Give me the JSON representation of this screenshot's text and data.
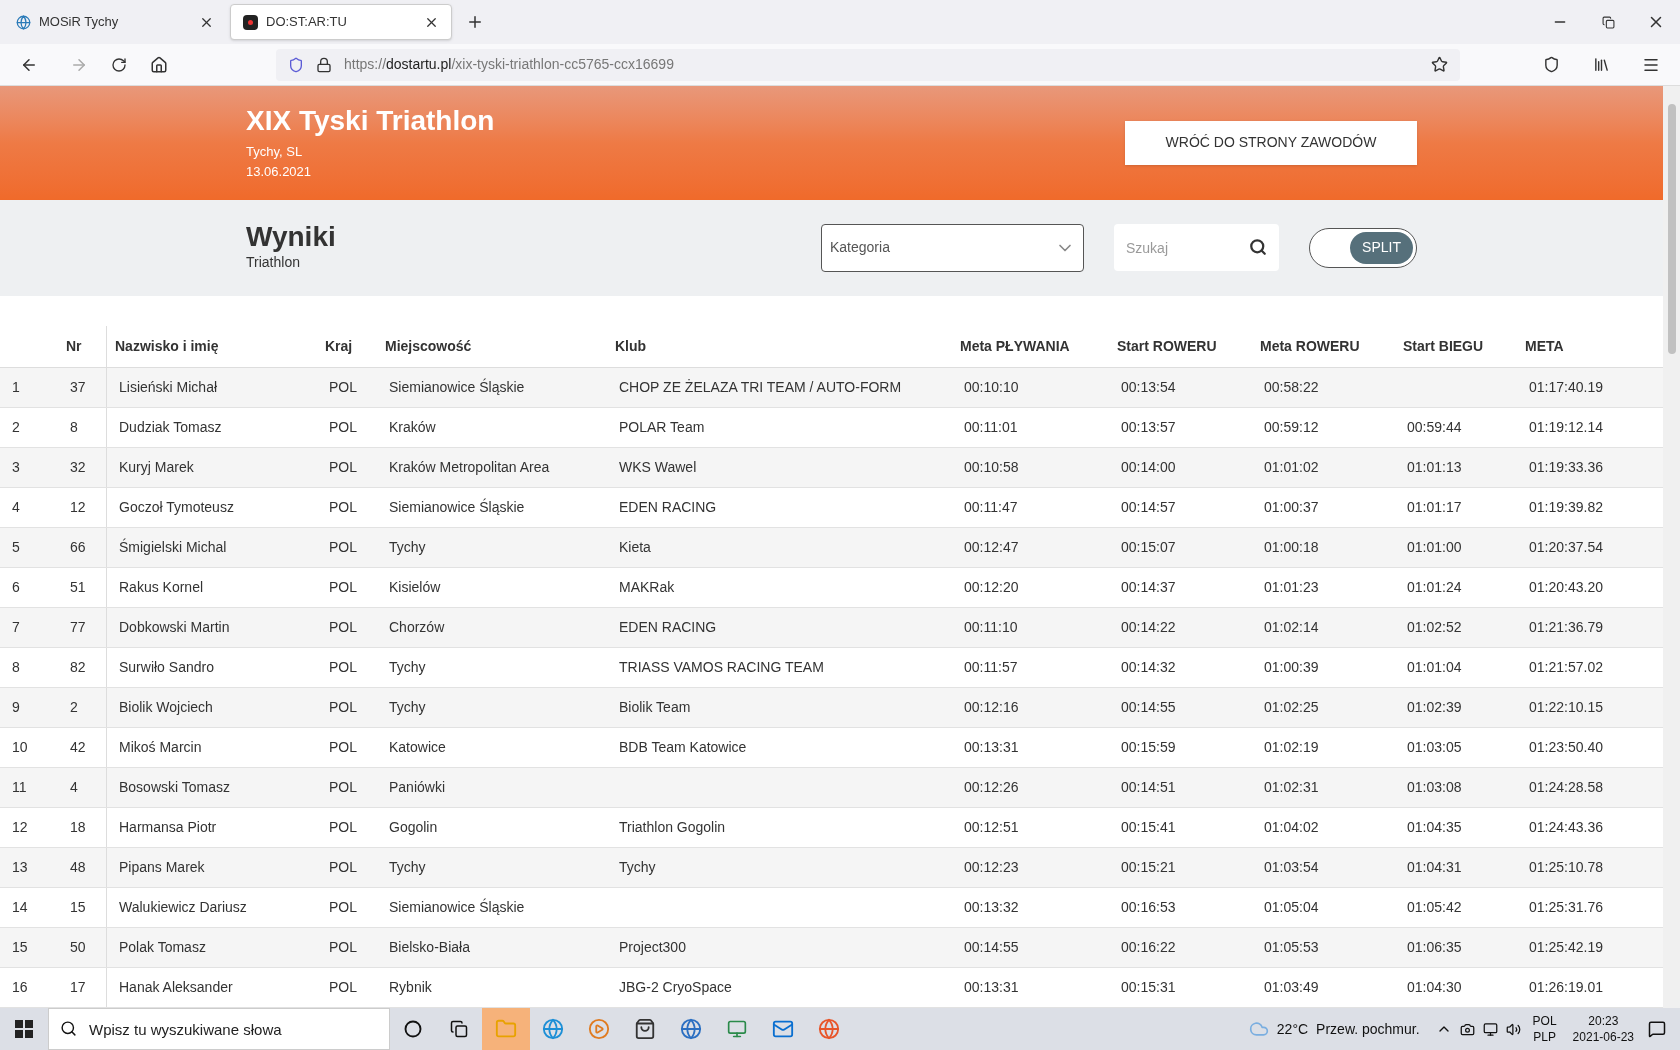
{
  "browser": {
    "tabs": [
      {
        "title": "MOSiR Tychy",
        "selected": false
      },
      {
        "title": "DO:ST:AR:TU",
        "selected": true
      }
    ],
    "url": {
      "scheme": "https://",
      "domain": "dostartu.pl",
      "path": "/xix-tyski-triathlon-cc5765-ccx16699"
    }
  },
  "event": {
    "title": "XIX Tyski Triathlon",
    "location": "Tychy, SL",
    "date": "13.06.2021",
    "back_button": "WRÓĆ DO STRONY ZAWODÓW"
  },
  "results": {
    "title": "Wyniki",
    "subtitle": "Triathlon",
    "category_placeholder": "Kategoria",
    "search_placeholder": "Szukaj",
    "split": {
      "label": "SPLIT",
      "on": true
    }
  },
  "table": {
    "columns": [
      "",
      "Nr",
      "Nazwisko i imię",
      "Kraj",
      "Miejscowość",
      "Klub",
      "Meta PŁYWANIA",
      "Start ROWERU",
      "Meta ROWERU",
      "Start BIEGU",
      "META"
    ],
    "rows": [
      {
        "place": "1",
        "nr": "37",
        "name": "Lisieński Michał",
        "country": "POL",
        "city": "Siemianowice Śląskie",
        "club": "CHOP ZE ŻELAZA TRI TEAM / AUTO-FORM",
        "swim_finish": "00:10:10",
        "bike_start": "00:13:54",
        "bike_finish": "00:58:22",
        "finish": "01:17:40.19"
      },
      {
        "place": "2",
        "nr": "8",
        "name": "Dudziak Tomasz",
        "country": "POL",
        "city": "Kraków",
        "club": "POLAR Team",
        "swim_finish": "00:11:01",
        "bike_start": "00:13:57",
        "bike_finish": "00:59:12",
        "run_start": "00:59:44",
        "finish": "01:19:12.14"
      },
      {
        "place": "3",
        "nr": "32",
        "name": "Kuryj Marek",
        "country": "POL",
        "city": "Kraków Metropolitan Area",
        "club": "WKS Wawel",
        "swim_finish": "00:10:58",
        "bike_start": "00:14:00",
        "bike_finish": "01:01:02",
        "run_start": "01:01:13",
        "finish": "01:19:33.36"
      },
      {
        "place": "4",
        "nr": "12",
        "name": "Goczoł Tymoteusz",
        "country": "POL",
        "city": "Siemianowice Śląskie",
        "club": "EDEN RACING",
        "swim_finish": "00:11:47",
        "bike_start": "00:14:57",
        "bike_finish": "01:00:37",
        "run_start": "01:01:17",
        "finish": "01:19:39.82"
      },
      {
        "place": "5",
        "nr": "66",
        "name": "Śmigielski Michal",
        "country": "POL",
        "city": "Tychy",
        "club": "Kieta",
        "swim_finish": "00:12:47",
        "bike_start": "00:15:07",
        "bike_finish": "01:00:18",
        "run_start": "01:01:00",
        "finish": "01:20:37.54"
      },
      {
        "place": "6",
        "nr": "51",
        "name": "Rakus Kornel",
        "country": "POL",
        "city": "Kisielów",
        "club": "MAKRak",
        "swim_finish": "00:12:20",
        "bike_start": "00:14:37",
        "bike_finish": "01:01:23",
        "run_start": "01:01:24",
        "finish": "01:20:43.20"
      },
      {
        "place": "7",
        "nr": "77",
        "name": "Dobkowski Martin",
        "country": "POL",
        "city": "Chorzów",
        "club": "EDEN RACING",
        "swim_finish": "00:11:10",
        "bike_start": "00:14:22",
        "bike_finish": "01:02:14",
        "run_start": "01:02:52",
        "finish": "01:21:36.79"
      },
      {
        "place": "8",
        "nr": "82",
        "name": "Surwiło Sandro",
        "country": "POL",
        "city": "Tychy",
        "club": "TRIASS VAMOS RACING TEAM",
        "swim_finish": "00:11:57",
        "bike_start": "00:14:32",
        "bike_finish": "01:00:39",
        "run_start": "01:01:04",
        "finish": "01:21:57.02"
      },
      {
        "place": "9",
        "nr": "2",
        "name": "Biolik Wojciech",
        "country": "POL",
        "city": "Tychy",
        "club": "Biolik Team",
        "swim_finish": "00:12:16",
        "bike_start": "00:14:55",
        "bike_finish": "01:02:25",
        "run_start": "01:02:39",
        "finish": "01:22:10.15"
      },
      {
        "place": "10",
        "nr": "42",
        "name": "Mikoś Marcin",
        "country": "POL",
        "city": "Katowice",
        "club": "BDB Team Katowice",
        "swim_finish": "00:13:31",
        "bike_start": "00:15:59",
        "bike_finish": "01:02:19",
        "run_start": "01:03:05",
        "finish": "01:23:50.40"
      },
      {
        "place": "11",
        "nr": "4",
        "name": "Bosowski Tomasz",
        "country": "POL",
        "city": "Paniówki",
        "swim_finish": "00:12:26",
        "bike_start": "00:14:51",
        "bike_finish": "01:02:31",
        "run_start": "01:03:08",
        "finish": "01:24:28.58"
      },
      {
        "place": "12",
        "nr": "18",
        "name": "Harmansa Piotr",
        "country": "POL",
        "city": "Gogolin",
        "club": "Triathlon Gogolin",
        "swim_finish": "00:12:51",
        "bike_start": "00:15:41",
        "bike_finish": "01:04:02",
        "run_start": "01:04:35",
        "finish": "01:24:43.36"
      },
      {
        "place": "13",
        "nr": "48",
        "name": "Pipans Marek",
        "country": "POL",
        "city": "Tychy",
        "club": "Tychy",
        "swim_finish": "00:12:23",
        "bike_start": "00:15:21",
        "bike_finish": "01:03:54",
        "run_start": "01:04:31",
        "finish": "01:25:10.78"
      },
      {
        "place": "14",
        "nr": "15",
        "name": "Walukiewicz Dariusz",
        "country": "POL",
        "city": "Siemianowice Śląskie",
        "swim_finish": "00:13:32",
        "bike_start": "00:16:53",
        "bike_finish": "01:05:04",
        "run_start": "01:05:42",
        "finish": "01:25:31.76"
      },
      {
        "place": "15",
        "nr": "50",
        "name": "Polak Tomasz",
        "country": "POL",
        "city": "Bielsko-Biała",
        "club": "Project300",
        "swim_finish": "00:14:55",
        "bike_start": "00:16:22",
        "bike_finish": "01:05:53",
        "run_start": "01:06:35",
        "finish": "01:25:42.19"
      },
      {
        "place": "16",
        "nr": "17",
        "name": "Hanak Aleksander",
        "country": "POL",
        "city": "Rybnik",
        "club": "JBG-2 CryoSpace",
        "swim_finish": "00:13:31",
        "bike_start": "00:15:31",
        "bike_finish": "01:03:49",
        "run_start": "01:04:30",
        "finish": "01:26:19.01"
      }
    ]
  },
  "taskbar": {
    "search_placeholder": "Wpisz tu wyszukiwane słowa",
    "weather": {
      "temperature": "22°C",
      "condition": "Przew. pochmur."
    },
    "language": {
      "top": "POL",
      "bottom": "PLP"
    },
    "clock": {
      "time": "20:23",
      "date": "2021-06-23"
    }
  }
}
